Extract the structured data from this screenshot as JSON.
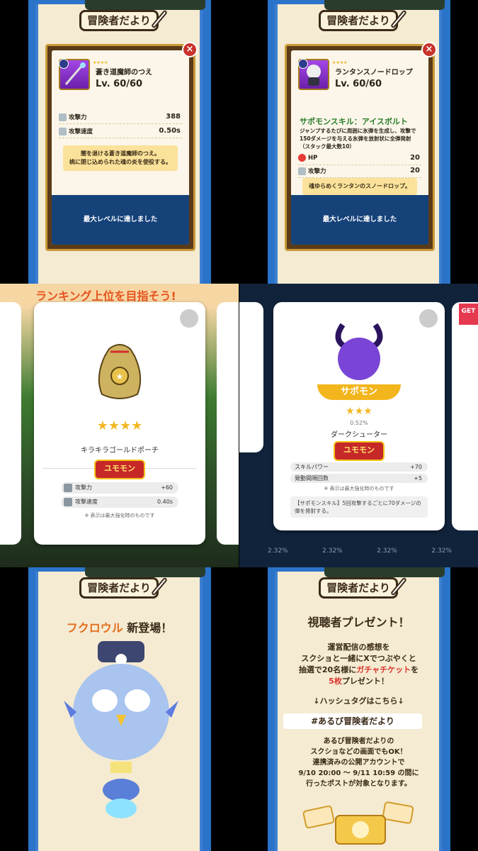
{
  "header": {
    "banner_title": "冒険者だより"
  },
  "panel1": {
    "item_name": "蒼き道魔師のつえ",
    "level": "Lv. 60/60",
    "stats": [
      {
        "label": "攻撃力",
        "value": "388"
      },
      {
        "label": "攻撃速度",
        "value": "0.50s"
      }
    ],
    "description_line1": "闇を退ける蒼き道魔師のつえ。",
    "description_line2": "桃に閉じ込められた魂の炎を使役する。",
    "max_level": "最大レベルに達しました",
    "close_label": "×"
  },
  "panel2": {
    "item_name": "ランタンスノードロップ",
    "level": "Lv. 60/60",
    "skill_title": "サポモンスキル：アイスボルト",
    "skill_desc": "ジャンプするたびに周囲に氷弾を生成し、攻撃で150ダメージを与える氷弾を放射状に全弾発射（スタック最大数10）",
    "stats": [
      {
        "label": "HP",
        "value": "20"
      },
      {
        "label": "攻撃力",
        "value": "20"
      }
    ],
    "description": "魂ゆらめくランタンのスノードロップ。",
    "max_level": "最大レベルに達しました",
    "close_label": "×"
  },
  "panel3": {
    "title": "ランキング上位を目指そう!",
    "stars": "★★★★",
    "item_name": "キラキラゴールドポーチ",
    "logo": "ユモモン",
    "stats": [
      {
        "label": "攻撃力",
        "value": "+60"
      },
      {
        "label": "攻撃速度",
        "value": "0.40s"
      }
    ],
    "note": "※ 表示は最大強化時のものです"
  },
  "panel4": {
    "badge": "GET",
    "ribbon": "サポモン",
    "stars": "★★★",
    "rate": "0.52%",
    "item_name": "ダークシューター",
    "logo": "ユモモン",
    "stats": [
      {
        "label": "スキルパワー",
        "value": "+70"
      },
      {
        "label": "発動間隔回数",
        "value": "+5"
      }
    ],
    "note": "※ 表示は最大強化時のものです",
    "skill_text": "【サポモンスキル】5回攻撃するごとに70ダメージの弾を発射する。",
    "bg_rates": [
      "2.32%",
      "2.32%",
      "2.32%",
      "2.32%"
    ]
  },
  "panel5": {
    "title_name": "フクロウル",
    "title_rest": "新登場！"
  },
  "panel6": {
    "title": "視聴者プレゼント！",
    "line1": "運営配信の感想を",
    "line2": "スクショと一緒にXでつぶやくと",
    "line3_a": "抽選で20名様に",
    "line3_b": "ガチャチケット",
    "line3_c": "を",
    "line4_a": "5枚",
    "line4_b": "プレゼント！",
    "hashtag_label": "↓ハッシュタグはこちら↓",
    "hashtag": "#あるび冒険者だより",
    "line5": "あるび冒険者だよりの",
    "line6": "スクショなどの画面でもOK！",
    "line7": "連携済みの公開アカウントで",
    "line8": "9/10 20:00 ～ 9/11 10:59 の間に",
    "line9": "行ったポストが対象となります。"
  },
  "colors": {
    "accent_orange": "#e56d1e",
    "accent_red": "#d9342b",
    "navy": "#16427a",
    "gold": "#f2b823"
  }
}
